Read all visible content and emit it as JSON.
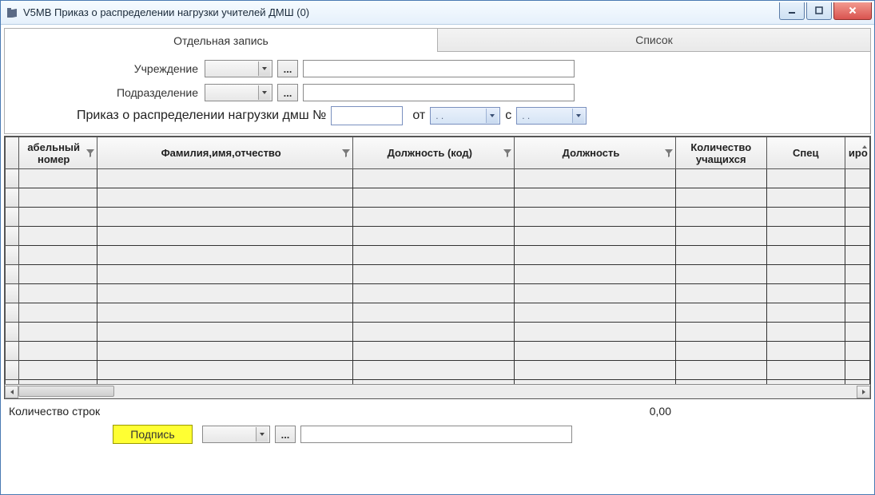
{
  "window": {
    "title": "V5MB Приказ о распределении нагрузки учителей ДМШ (0)"
  },
  "tabs": {
    "single": "Отдельная запись",
    "list": "Список"
  },
  "form": {
    "institution_label": "Учреждение",
    "department_label": "Подразделение",
    "dots": "...",
    "institution_value": "",
    "institution_text": "",
    "department_value": "",
    "department_text": ""
  },
  "order": {
    "caption": "Приказ о распределении нагрузки дмш №",
    "number": "",
    "from_label": "от",
    "since_label": "с",
    "date_from": " .  .    ",
    "date_since": " .  .    "
  },
  "grid": {
    "headers": {
      "tabno": "абельный номер",
      "fio": "Фамилия,имя,отчество",
      "post_code": "Должность (код)",
      "post": "Должность",
      "students": "Количество учащихся",
      "spec": "Спец",
      "tail": "иро"
    },
    "row_count": 12
  },
  "footer": {
    "rows_label": "Количество строк",
    "rows_value": "0,00",
    "sign_label": "Подпись",
    "dots": "...",
    "sign_value": "",
    "sign_text": ""
  }
}
